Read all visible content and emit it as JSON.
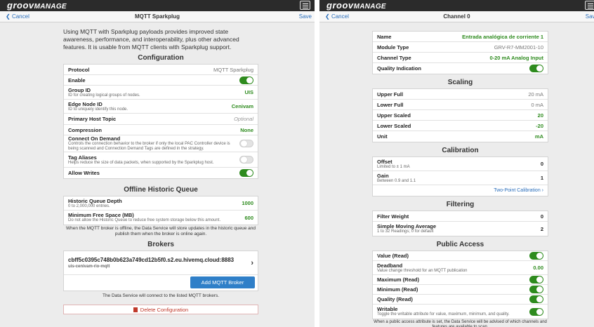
{
  "app": {
    "logo_prefix": "groov",
    "logo_suffix": "MANAGE"
  },
  "left": {
    "nav": {
      "cancel": "Cancel",
      "title": "MQTT Sparkplug",
      "save": "Save"
    },
    "intro": "Using MQTT with Sparkplug payloads provides improved state awareness, performance, and interoperability, plus other advanced features. It is usable from MQTT clients with Sparkplug support.",
    "configuration": {
      "heading": "Configuration",
      "protocol_label": "Protocol",
      "protocol_value": "MQTT Sparkplug",
      "enable_label": "Enable",
      "enable_on": true,
      "group_label": "Group ID",
      "group_sub": "ID for creating logical groups of nodes.",
      "group_value": "UIS",
      "edge_label": "Edge Node ID",
      "edge_sub": "ID to uniquely identify this node.",
      "edge_value": "Cenivam",
      "host_label": "Primary Host Topic",
      "host_placeholder": "Optional",
      "compression_label": "Compression",
      "compression_value": "None",
      "cod_label": "Connect On Demand",
      "cod_sub": "Controls the connection behavior to the broker if only the local PAC Controller device is being scanned and Connection Demand Tags are defined in the strategy.",
      "cod_on": false,
      "alias_label": "Tag Aliases",
      "alias_sub": "Helps reduce the size of data packets, when supported by the Sparkplug host.",
      "alias_on": false,
      "writes_label": "Allow Writes",
      "writes_on": true
    },
    "queue": {
      "heading": "Offline Historic Queue",
      "depth_label": "Historic Queue Depth",
      "depth_sub": "0 to 2,000,000 entries.",
      "depth_value": "1000",
      "free_label": "Minimum Free Space (MB)",
      "free_sub": "Do not allow the Historic Queue to reduce free system storage below this amount.",
      "free_value": "600",
      "note": "When the MQTT broker is offline, the Data Service will store updates in the historic queue and publish them when the broker is online again."
    },
    "brokers": {
      "heading": "Brokers",
      "broker_name": "cbff5c0395c748b0b623a749cd12b5f0.s2.eu.hivemq.cloud:8883",
      "broker_sub": "uis-cenivam-rio-mqtt",
      "add_button": "Add MQTT Broker",
      "note": "The Data Service will connect to the listed MQTT brokers."
    },
    "delete_button": "Delete Configuration"
  },
  "right": {
    "nav": {
      "cancel": "Cancel",
      "title": "Channel 0",
      "save": "Save"
    },
    "info": {
      "name_label": "Name",
      "name_value": "Entrada analógica de corriente 1",
      "module_label": "Module Type",
      "module_value": "GRV-R7-MM2001-10",
      "channel_label": "Channel Type",
      "channel_value": "0-20 mA Analog Input",
      "quality_label": "Quality Indication",
      "quality_on": true
    },
    "scaling": {
      "heading": "Scaling",
      "upper_full_label": "Upper Full",
      "upper_full_value": "20 mA",
      "lower_full_label": "Lower Full",
      "lower_full_value": "0 mA",
      "upper_scaled_label": "Upper Scaled",
      "upper_scaled_value": "20",
      "lower_scaled_label": "Lower Scaled",
      "lower_scaled_value": "-20",
      "unit_label": "Unit",
      "unit_value": "mA"
    },
    "calibration": {
      "heading": "Calibration",
      "offset_label": "Offset",
      "offset_sub": "Limited to ± 1 mA",
      "offset_value": "0",
      "gain_label": "Gain",
      "gain_sub": "Between 0.9 and 1.1",
      "gain_value": "1",
      "two_point": "Two-Point Calibration"
    },
    "filtering": {
      "heading": "Filtering",
      "weight_label": "Filter Weight",
      "weight_value": "0",
      "sma_label": "Simple Moving Average",
      "sma_sub": "1 to 32 Readings; 0 for default",
      "sma_value": "2"
    },
    "public_access": {
      "heading": "Public Access",
      "value_label": "Value (Read)",
      "value_on": true,
      "deadband_label": "Deadband",
      "deadband_sub": "Value change threshold for an MQTT publication",
      "deadband_value": "0.00",
      "max_label": "Maximum (Read)",
      "max_on": true,
      "min_label": "Minimum (Read)",
      "min_on": true,
      "quality_label": "Quality (Read)",
      "quality_on": true,
      "writable_label": "Writable",
      "writable_sub": "Toggle the writable attribute for value, maximum, minimum, and quality.",
      "writable_on": true,
      "note": "When a public access attribute is set, the Data Service will be advised of which channels and features are available to scan."
    }
  }
}
